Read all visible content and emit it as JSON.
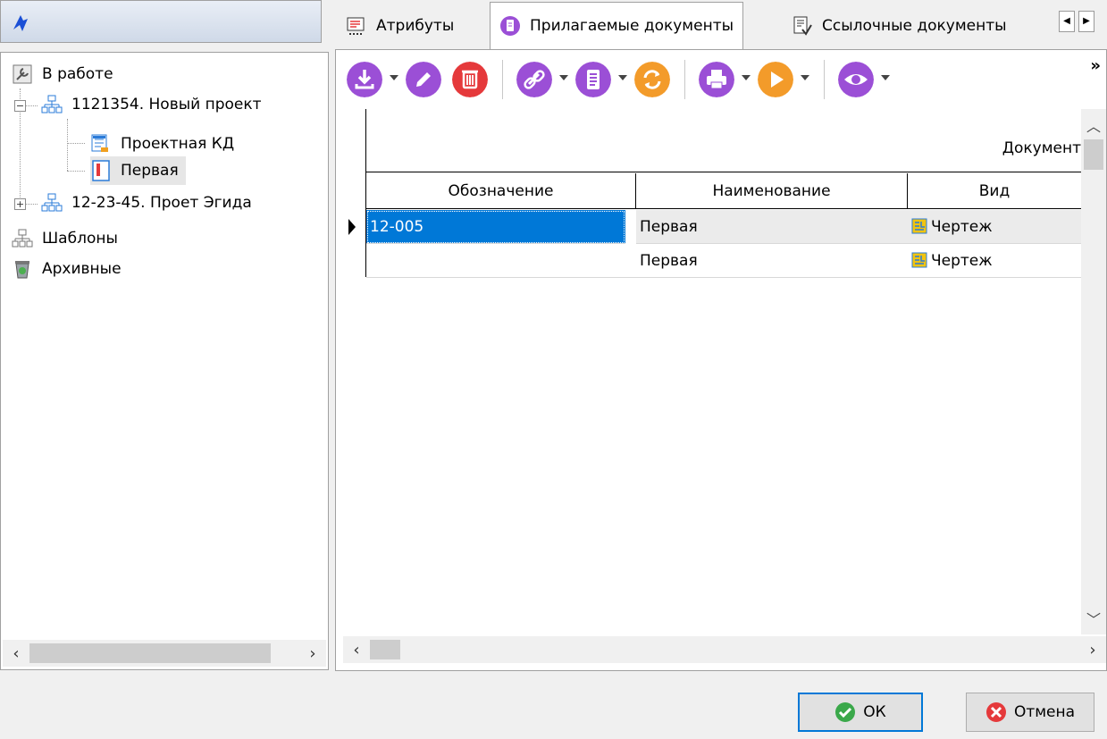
{
  "tree": {
    "items": [
      {
        "label": "В работе",
        "icon": "tools-icon"
      },
      {
        "label": "1121354. Новый проект",
        "icon": "project-hierarchy-icon",
        "expander": "−"
      },
      {
        "label": "Проектная КД",
        "icon": "design-doc-icon"
      },
      {
        "label": "Первая",
        "icon": "document-red-icon"
      },
      {
        "label": "12-23-45. Проет Эгида",
        "icon": "project-hierarchy-icon",
        "expander": "+"
      },
      {
        "label": "Шаблоны",
        "icon": "templates-icon"
      },
      {
        "label": "Архивные",
        "icon": "archive-icon"
      }
    ]
  },
  "tabs": [
    {
      "label": "Атрибуты",
      "icon": "attributes-icon"
    },
    {
      "label": "Прилагаемые документы",
      "icon": "attached-docs-icon",
      "active": true
    },
    {
      "label": "Ссылочные документы",
      "icon": "reference-docs-icon"
    }
  ],
  "toolbar": {
    "buttons": [
      "download-icon",
      "edit-icon",
      "delete-icon",
      "link-icon",
      "document-list-icon",
      "refresh-icon",
      "print-icon",
      "play-icon",
      "view-icon"
    ],
    "more_label": "»",
    "colors": {
      "purple": "#9b4fd6",
      "red": "#e5393b",
      "orange": "#f39b2a"
    }
  },
  "grid": {
    "band_title": "Документ",
    "columns": [
      "Обозначение",
      "Наименование",
      "Вид"
    ],
    "rows": [
      {
        "designation": "12-005",
        "name": "Первая",
        "kind": "Чертеж",
        "selected": true
      },
      {
        "designation": "",
        "name": "Первая",
        "kind": "Чертеж",
        "selected": false
      }
    ]
  },
  "buttons": {
    "ok": "ОК",
    "cancel": "Отмена"
  }
}
